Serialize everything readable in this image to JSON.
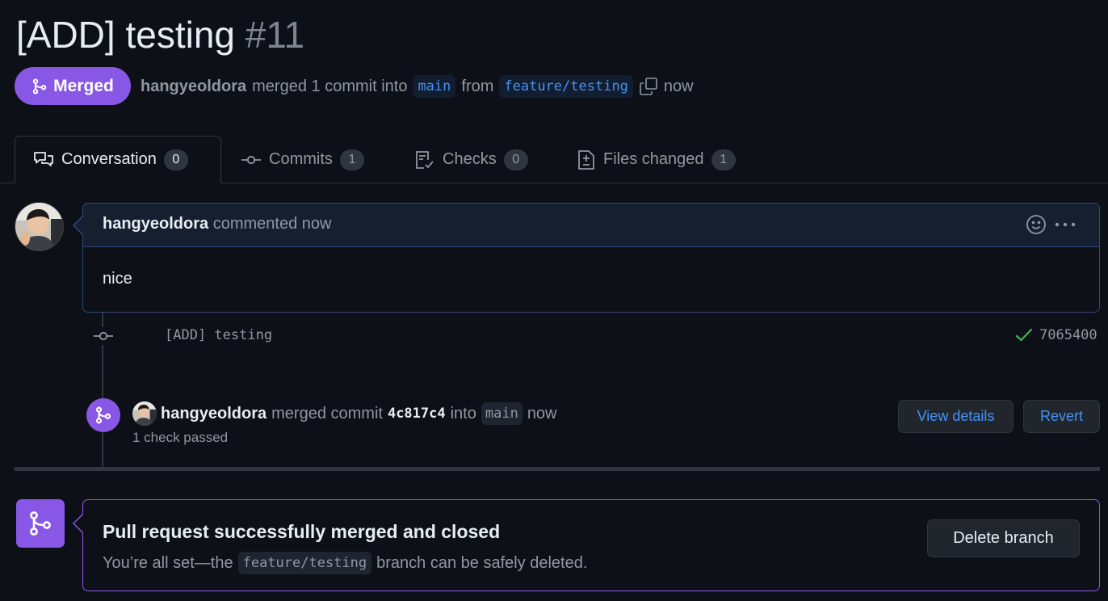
{
  "pr": {
    "title": "[ADD] testing",
    "number": "#11",
    "state": "Merged",
    "author": "hangyeoldora",
    "action": "merged 1 commit into",
    "base_branch": "main",
    "from_text": "from",
    "head_branch": "feature/testing",
    "time": "now"
  },
  "tabs": [
    {
      "label": "Conversation",
      "count": "0",
      "icon": "comment-discussion-icon"
    },
    {
      "label": "Commits",
      "count": "1",
      "icon": "git-commit-icon"
    },
    {
      "label": "Checks",
      "count": "0",
      "icon": "checklist-icon"
    },
    {
      "label": "Files changed",
      "count": "1",
      "icon": "file-diff-icon"
    }
  ],
  "comment": {
    "author": "hangyeoldora",
    "action": "commented now",
    "body": "nice"
  },
  "commit": {
    "message": "[ADD] testing",
    "sha": "7065400",
    "status_icon": "check-icon"
  },
  "merge_event": {
    "author": "hangyeoldora",
    "action": "merged commit",
    "sha": "4c817c4",
    "into": "into",
    "branch": "main",
    "time": "now",
    "checks": "1 check passed",
    "view_details": "View details",
    "revert": "Revert"
  },
  "merged_box": {
    "title": "Pull request successfully merged and closed",
    "desc_before": "You’re all set—the",
    "branch": "feature/testing",
    "desc_after": "branch can be safely deleted.",
    "delete_button": "Delete branch"
  },
  "colors": {
    "background": "#0d1117",
    "merged_purple": "#8957e5",
    "link_blue": "#4493f8",
    "success_green": "#3fb950"
  }
}
